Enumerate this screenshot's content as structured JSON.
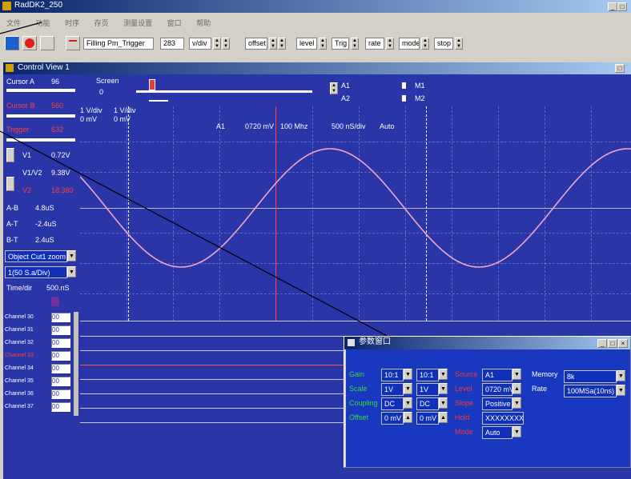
{
  "app": {
    "title": "RadDK2_250"
  },
  "menu": {
    "items": [
      "文件",
      "功能",
      "时序",
      "存页",
      "测量设置",
      "窗口",
      "帮助"
    ]
  },
  "toolbar": {
    "trigger_mode": "Filling Pm_Trigger",
    "value_field": "283",
    "vdiv_label": "v/div",
    "offset_label": "offset",
    "level_label": "level",
    "trig_label": "Trig",
    "rate_label": "rate",
    "mode_label": "mode",
    "stop_label": "stop"
  },
  "scope_window": {
    "title": "Control View 1"
  },
  "cursors": {
    "cursor_a_label": "Cursor A",
    "cursor_a_value": "96",
    "cursor_b_label": "Cursor B",
    "cursor_b_value": "560",
    "trigger_label": "Trigger",
    "trigger_value": "632"
  },
  "screen": {
    "label": "Screen",
    "value": "0"
  },
  "slots": {
    "a1": "A1",
    "a2": "A2",
    "m1": "M1",
    "m2": "M2"
  },
  "measures": {
    "v1_label": "V1",
    "v1_value": "0.72V",
    "v1v2_label": "V1/V2",
    "v1v2_value": "9.38V",
    "v2_label": "V2",
    "v2_value": "18.380",
    "ab_label": "A-B",
    "ab_value": "4.8uS",
    "at_label": "A-T",
    "at_value": "-2.4uS",
    "bt_label": "B-T",
    "bt_value": "2.4uS"
  },
  "dropdowns": {
    "object": "Object Cut1 zoom",
    "rate": "1(50 S.a/Div)"
  },
  "timediv": {
    "label": "Time/dir",
    "value": "500.nS"
  },
  "channels": [
    {
      "name": "Channel 30",
      "value": "00"
    },
    {
      "name": "Channel 31",
      "value": "00"
    },
    {
      "name": "Channel 32",
      "value": "00"
    },
    {
      "name": "Channel 33",
      "value": "00"
    },
    {
      "name": "Channel 34",
      "value": "00"
    },
    {
      "name": "Channel 35",
      "value": "00"
    },
    {
      "name": "Channel 36",
      "value": "00"
    },
    {
      "name": "Channel 37",
      "value": "00"
    }
  ],
  "plot_header": {
    "ch1_vdiv": "1 V/div",
    "ch1_offset": "0 mV",
    "ch2_vdiv": "1 V/div",
    "ch2_offset": "0 mV",
    "source": "A1",
    "level": "0720 mV",
    "freq": "100 Mhz",
    "timebase": "500 nS/div",
    "mode": "Auto"
  },
  "param_window": {
    "title": "参数窗口",
    "row_labels": [
      "Gain",
      "Scale",
      "Coupling",
      "Offset"
    ],
    "col1": [
      "10:1",
      "1V",
      "DC",
      "0 mV"
    ],
    "col2": [
      "10:1",
      "1V",
      "DC",
      "0 mV"
    ],
    "trig_labels": [
      "Source",
      "Level",
      "Slope",
      "Hold",
      "Mode"
    ],
    "source": "A1",
    "level": "0720 mV",
    "slope": "Positive",
    "hold": "XXXXXXXX",
    "mode": "Auto",
    "memory_label": "Memory",
    "memory": "8k",
    "rate_label": "Rate",
    "rate": "100MSa(10ns)"
  },
  "colors": {
    "plot_bg": "#2a35a8",
    "trace": "#f0a8c8",
    "accent": "#0a246a"
  }
}
